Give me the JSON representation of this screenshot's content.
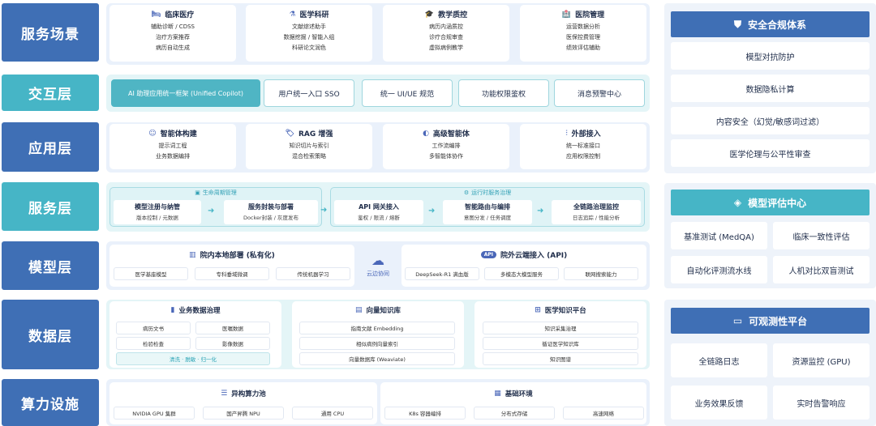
{
  "layers": {
    "service_scene": "服务场景",
    "interaction": "交互层",
    "application": "应用层",
    "service": "服务层",
    "model": "模型层",
    "data": "数据层",
    "compute": "算力设施"
  },
  "scene_cards": [
    {
      "icon": "bed-icon",
      "glyph": "🛏",
      "title": "临床医疗",
      "lines": [
        "辅助诊断 / CDSS",
        "治疗方案推荐",
        "病历自动生成"
      ]
    },
    {
      "icon": "flask-icon",
      "glyph": "⚗",
      "title": "医学科研",
      "lines": [
        "文献综述助手",
        "数据挖掘 / 智能入组",
        "科研论文润色"
      ]
    },
    {
      "icon": "graduation-cap-icon",
      "glyph": "🎓",
      "title": "教学质控",
      "lines": [
        "病历内涵质控",
        "诊疗合规审查",
        "虚拟病例教学"
      ]
    },
    {
      "icon": "hospital-icon",
      "glyph": "🏥",
      "title": "医院管理",
      "lines": [
        "运营数据分析",
        "医保控费管理",
        "绩效评估辅助"
      ]
    }
  ],
  "interaction": {
    "items": [
      "AI 助理应用统一框架 (Unified Copilot)",
      "用户统一入口 SSO",
      "统一 UI/UE 规范",
      "功能权限鉴权",
      "消息预警中心"
    ]
  },
  "app_cards": [
    {
      "icon": "robot-icon",
      "glyph": "☺",
      "title": "智能体构建",
      "lines": [
        "提示词工程",
        "业务数据编排"
      ]
    },
    {
      "icon": "tag-icon",
      "glyph": "🏷",
      "title": "RAG 增强",
      "lines": [
        "知识切片与索引",
        "混合检索策略"
      ]
    },
    {
      "icon": "brain-icon",
      "glyph": "◐",
      "title": "高级智能体",
      "lines": [
        "工作流编排",
        "多智能体协作"
      ]
    },
    {
      "icon": "sliders-icon",
      "glyph": "⫶",
      "title": "外部接入",
      "lines": [
        "统一标准接口",
        "应用权限控制"
      ]
    }
  ],
  "service": {
    "lifecycle_title": "生命周期管理",
    "runtime_title": "运行时服务治理",
    "items": [
      {
        "t": "模型注册与纳管",
        "s": "版本控制 / 元数据"
      },
      {
        "t": "服务封装与部署",
        "s": "Docker封装 / 灰度发布"
      },
      {
        "t": "API 网关接入",
        "s": "鉴权 / 限流 / 熔断"
      },
      {
        "t": "智能路由与编排",
        "s": "意图分发 / 任务调度"
      },
      {
        "t": "全链路治理监控",
        "s": "日志追踪 / 性能分析"
      }
    ]
  },
  "model": {
    "local_title": "院内本地部署 (私有化)",
    "local_items": [
      "医学基座模型",
      "专科垂域微调",
      "传统机器学习"
    ],
    "cloud_link": "云边协同",
    "remote_title": "院外云端接入 (API)",
    "remote_badge": "API",
    "remote_items": [
      "DeepSeek-R1 满血版",
      "多模态大模型服务",
      "联网搜索能力"
    ]
  },
  "data": {
    "governance_title": "业务数据治理",
    "governance_items": [
      "病历文书",
      "医嘱数据",
      "检验检查",
      "影像数据"
    ],
    "governance_footer": "清洗 · 脱敏 · 归一化",
    "vector_title": "向量知识库",
    "vector_items": [
      "指南文献 Embedding",
      "相似病例向量索引",
      "向量数据库 (Weaviate)"
    ],
    "kg_title": "医学知识平台",
    "kg_items": [
      "知识采集治理",
      "循证医学知识库",
      "知识图谱"
    ]
  },
  "compute": {
    "pool_title": "异构算力池",
    "pool_items": [
      "NVIDIA GPU 集群",
      "国产昇腾 NPU",
      "通用 CPU"
    ],
    "env_title": "基础环境",
    "env_items": [
      "K8s 容器编排",
      "分布式存储",
      "高速网络"
    ]
  },
  "right": {
    "security_title": "安全合规体系",
    "security_items": [
      "模型对抗防护",
      "数据隐私计算",
      "内容安全（幻觉/敏感词过滤）",
      "医学伦理与公平性审查"
    ],
    "eval_title": "模型评估中心",
    "eval_items": [
      "基准测试 (MedQA)",
      "临床一致性评估",
      "自动化评测流水线",
      "人机对比双盲测试"
    ],
    "obs_title": "可观测性平台",
    "obs_items": [
      "全链路日志",
      "资源监控 (GPU)",
      "业务效果反馈",
      "实时告警响应"
    ]
  },
  "colors": {
    "primary": "#3f6fb5",
    "teal": "#46b5c6"
  }
}
